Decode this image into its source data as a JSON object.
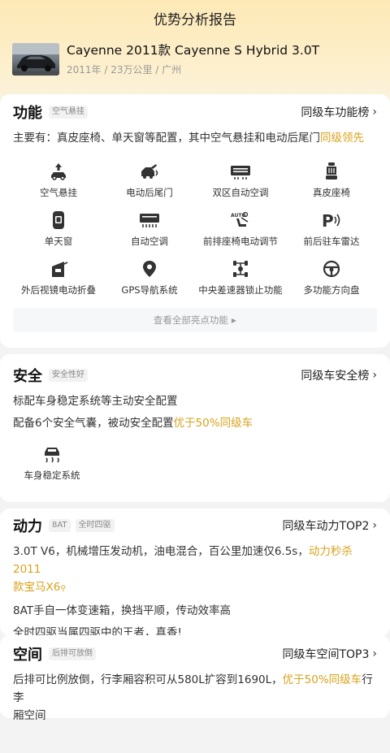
{
  "header": {
    "title": "优势分析报告"
  },
  "car": {
    "name": "Cayenne 2011款 Cayenne S Hybrid 3.0T",
    "meta": "2011年 / 23万公里 / 广州"
  },
  "function": {
    "title": "功能",
    "tag": "空气悬挂",
    "rank": "同级车功能榜",
    "summary_prefix": "主要有：真皮座椅、单天窗等配置，其中空气悬挂和电动后尾门",
    "summary_highlight": "同级领先",
    "features": [
      {
        "label": "空气悬挂",
        "icon": "air-suspension-icon"
      },
      {
        "label": "电动后尾门",
        "icon": "power-tailgate-icon"
      },
      {
        "label": "双区自动空调",
        "icon": "dual-zone-ac-icon"
      },
      {
        "label": "真皮座椅",
        "icon": "leather-seat-icon"
      },
      {
        "label": "单天窗",
        "icon": "sunroof-icon"
      },
      {
        "label": "自动空调",
        "icon": "auto-ac-icon"
      },
      {
        "label": "前排座椅电动调节",
        "icon": "power-seat-icon"
      },
      {
        "label": "前后驻车雷达",
        "icon": "parking-radar-icon"
      },
      {
        "label": "外后视镜电动折叠",
        "icon": "mirror-fold-icon"
      },
      {
        "label": "GPS导航系统",
        "icon": "gps-icon"
      },
      {
        "label": "中央差速器锁止功能",
        "icon": "diff-lock-icon"
      },
      {
        "label": "多功能方向盘",
        "icon": "steering-wheel-icon"
      }
    ],
    "view_all": "查看全部亮点功能"
  },
  "safety": {
    "title": "安全",
    "tag": "安全性好",
    "rank": "同级车安全榜",
    "line1": "标配车身稳定系统等主动安全配置",
    "line2_prefix": "配备6个安全气囊，被动安全配置",
    "line2_highlight": "优于50%同级车",
    "feature": {
      "label": "车身稳定系统",
      "icon": "stability-control-icon"
    }
  },
  "power": {
    "title": "动力",
    "tags": [
      "8AT",
      "全时四驱"
    ],
    "rank": "同级车动力TOP2",
    "line1_prefix": "3.0T V6，机械增压发动机，油电混合，百公里加速仅6.5s，",
    "line1_highlight_a": "动力秒杀 2011",
    "line1_highlight_b": "款宝马X6",
    "line2": "8AT手自一体变速箱，换挡平顺，传动效率高",
    "line3": "全时四驱当属四驱中的王者，真香!"
  },
  "space": {
    "title": "空间",
    "tag": "后排可放倒",
    "rank": "同级车空间TOP3",
    "line1_prefix": "后排可比例放倒，行李厢容积可从580L扩容到1690L，",
    "line1_highlight": "优于50%同级车",
    "line1_suffix": "行李",
    "line2": "厢空间"
  },
  "colors": {
    "accent": "#d8a21c",
    "background_top": "#fde9b6"
  }
}
